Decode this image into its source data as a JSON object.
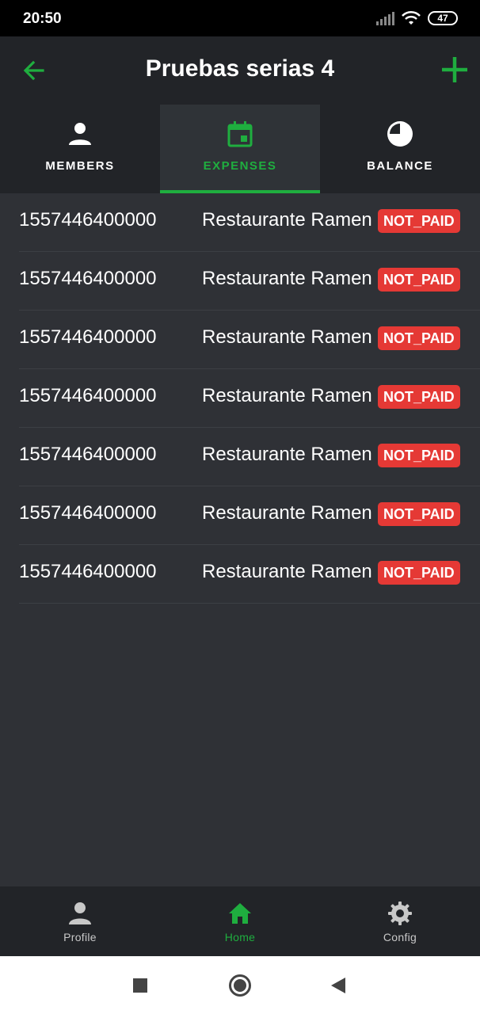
{
  "status_bar": {
    "time": "20:50",
    "battery": "47"
  },
  "app_bar": {
    "title": "Pruebas serias 4",
    "back_icon": "arrow-left-icon",
    "add_icon": "plus-icon"
  },
  "tabs": [
    {
      "label": "MEMBERS",
      "icon": "person-icon",
      "active": false
    },
    {
      "label": "EXPENSES",
      "icon": "calendar-icon",
      "active": true
    },
    {
      "label": "BALANCE",
      "icon": "pie-chart-icon",
      "active": false
    }
  ],
  "expenses": [
    {
      "date": "1557446400000",
      "description": "Restaurante Ramen",
      "status": "NOT_PAID"
    },
    {
      "date": "1557446400000",
      "description": "Restaurante Ramen",
      "status": "NOT_PAID"
    },
    {
      "date": "1557446400000",
      "description": "Restaurante Ramen",
      "status": "NOT_PAID"
    },
    {
      "date": "1557446400000",
      "description": "Restaurante Ramen",
      "status": "NOT_PAID"
    },
    {
      "date": "1557446400000",
      "description": "Restaurante Ramen",
      "status": "NOT_PAID"
    },
    {
      "date": "1557446400000",
      "description": "Restaurante Ramen",
      "status": "NOT_PAID"
    },
    {
      "date": "1557446400000",
      "description": "Restaurante Ramen",
      "status": "NOT_PAID"
    }
  ],
  "bottom_nav": [
    {
      "label": "Profile",
      "icon": "person-icon",
      "active": false
    },
    {
      "label": "Home",
      "icon": "home-icon",
      "active": true
    },
    {
      "label": "Config",
      "icon": "gear-icon",
      "active": false
    }
  ],
  "colors": {
    "accent": "#1fae3f",
    "badge": "#e53935",
    "background": "#2f3136",
    "bar": "#222428"
  }
}
